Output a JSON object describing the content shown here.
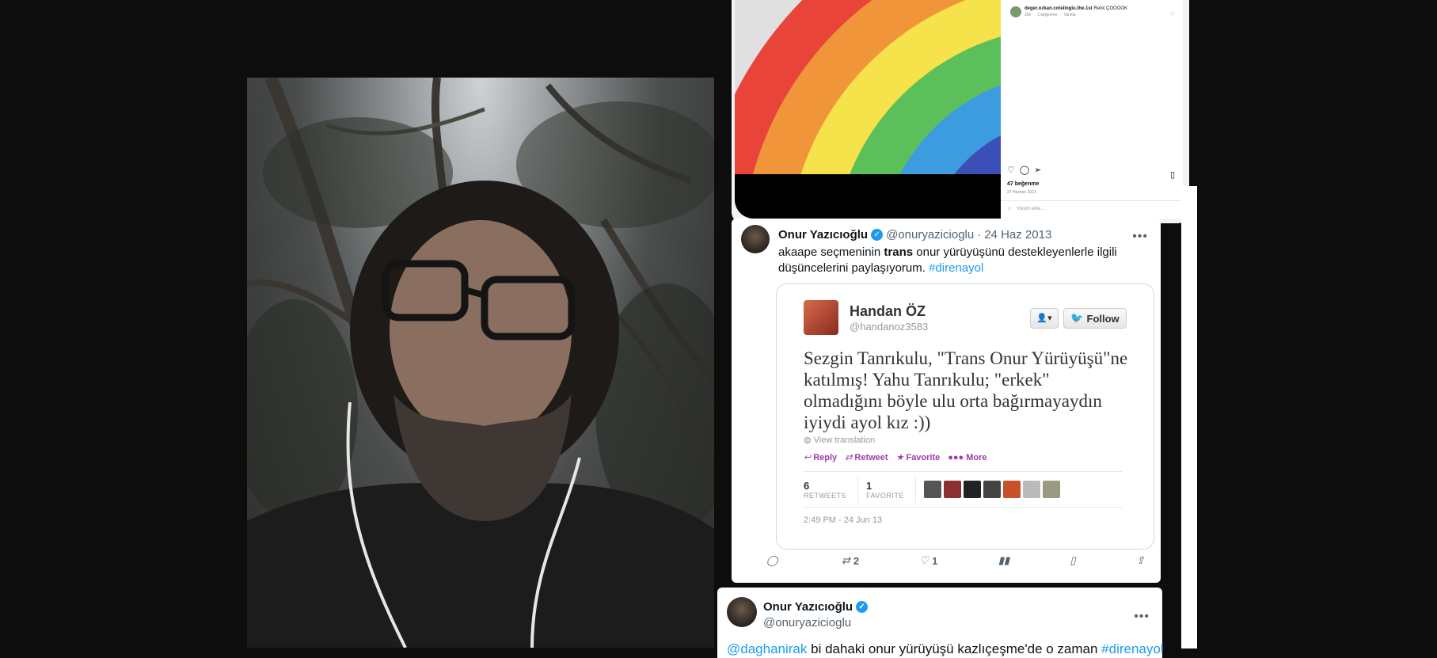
{
  "instagram": {
    "comment_user": "deger.ozkan.cotelloglu.the.1st",
    "comment_text": "Renk ÇOOOOK",
    "comment_age": "25h",
    "comment_likes": "1 beğenme",
    "comment_reply": "Yanıtla",
    "likes": "47 beğenme",
    "date": "27 Haziran 2021",
    "add_comment_placeholder": "Yorum ekle...",
    "rainbow_colors": [
      "#e8443a",
      "#f0953a",
      "#f6e24a",
      "#5cc05a",
      "#3d9be0",
      "#3b4fb8",
      "#7d3a9a"
    ]
  },
  "tweet1": {
    "name": "Onur Yazıcıoğlu",
    "handle": "@onuryazicioglu",
    "date": "24 Haz 2013",
    "text_before": "akaape seçmeninin ",
    "text_bold": "trans",
    "text_after": " onur yürüyüşünü destekleyenlerle ilgili düşüncelerini paylaşıyorum. ",
    "hashtag": "#direnayol",
    "more": "•••",
    "replies": "",
    "retweets": "2",
    "likes": "1"
  },
  "embed": {
    "name": "Handan ÖZ",
    "handle": "@handanoz3583",
    "follow_label": "Follow",
    "text": "Sezgin Tanrıkulu, \"Trans Onur Yürüyüşü\"ne katılmış! Yahu Tanrıkulu; \"erkek\" olmadığını böyle ulu orta bağırmayaydın iyiydi ayol kız :))",
    "translate": "View translation",
    "actions": {
      "reply": "Reply",
      "retweet": "Retweet",
      "favorite": "Favorite",
      "more": "More"
    },
    "retweets_num": "6",
    "retweets_lbl": "RETWEETS",
    "favorites_num": "1",
    "favorites_lbl": "FAVORITE",
    "time": "2:49 PM - 24 Jun 13"
  },
  "tweet2": {
    "name": "Onur Yazıcıoğlu",
    "handle": "@onuryazicioglu",
    "mention": "@daghanirak",
    "text": " bi dahaki onur yürüyüşü kazlıçeşme'de o zaman ",
    "hashtag": "#direnayol"
  }
}
